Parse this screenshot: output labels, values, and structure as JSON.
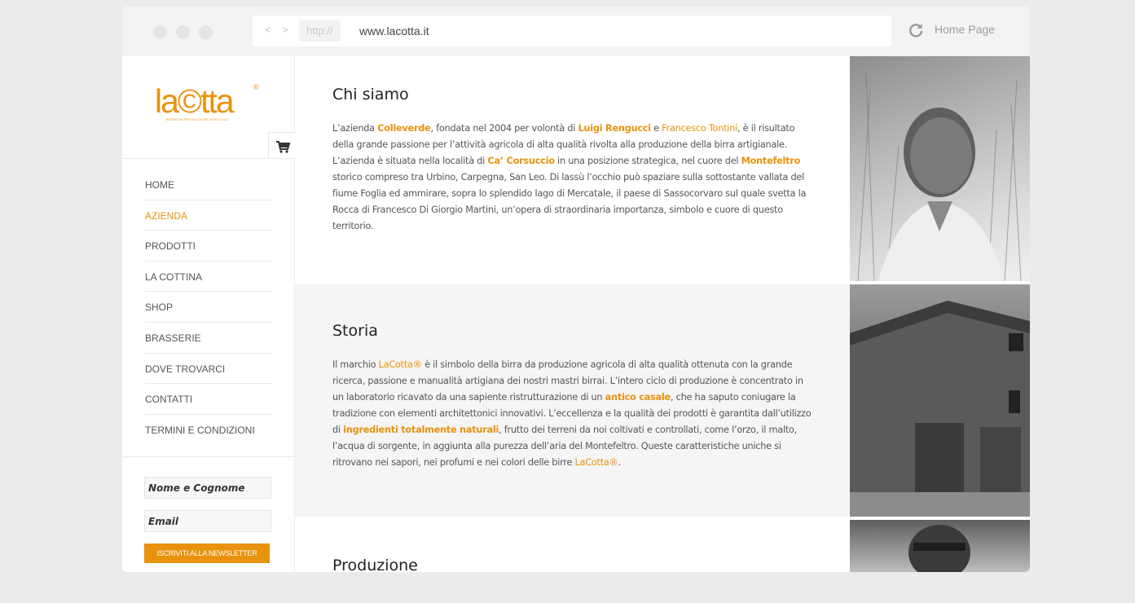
{
  "browser": {
    "nav_arrows": "< >",
    "protocol": "http://",
    "url": "www.lacotta.it",
    "home_link": "Home Page"
  },
  "logo": {
    "text": "la©tta",
    "registered": "®",
    "tagline": "BIRRA DA PRODUZIONE AGRICOLA"
  },
  "menu": {
    "items": [
      "HOME",
      "AZIENDA",
      "PRODOTTI",
      "LA COTTINA",
      "SHOP",
      "BRASSERIE",
      "DOVE TROVARCI",
      "CONTATTI",
      "TERMINI E CONDIZIONI"
    ],
    "active": "AZIENDA"
  },
  "newsletter": {
    "name_placeholder": "Nome e Cognome",
    "email_placeholder": "Email",
    "button": "ISCRIVITI ALLA NEWSLETTER"
  },
  "sections": {
    "chi_siamo": {
      "title": "Chi siamo",
      "t1": "L’azienda ",
      "h1": "Colleverde",
      "t2": ", fondata nel 2004 per volontà di ",
      "h2": "Luigi Rengucci",
      "t3": " e ",
      "h3": "Francesco Tontini",
      "t4": ", è il risultato della grande passione per l’attività agricola di alta qualità rivolta alla produzione della birra artigianale. L’azienda è situata nella località di ",
      "h4": "Ca’ Corsuccio",
      "t5": " in una posizione strategica, nel cuore del ",
      "h5": "Montefeltro",
      "t6": " storico compreso tra Urbino, Carpegna, San Leo. Di lassù l’occhio può spaziare sulla sottostante vallata del fiume Foglia ed ammirare, sopra lo splendido lago di Mercatale, il paese di Sassocorvaro sul quale svetta la Rocca di Francesco Di Giorgio Martini, un’opera di straordinaria importanza, simbolo e cuore di questo territorio."
    },
    "storia": {
      "title": "Storia",
      "t1": "Il marchio ",
      "h1": "LaCotta®",
      "t2": " è il simbolo della birra da produzione agricola di alta qualità ottenuta con la grande ricerca, passione e manualità artigiana dei nostri mastri birrai. L’intero ciclo di produzione è concentrato in un laboratorio ricavato da una sapiente ristrutturazione di un ",
      "h2": "antico casale",
      "t3": ", che ha saputo coniugare la tradizione con elementi architettonici innovativi. L’eccellenza e la qualità dei prodotti è garantita dall’utilizzo di ",
      "h3": "ingredienti totalmente naturali",
      "t4": ", frutto dei terreni da noi coltivati e controllati, come l’orzo, il malto, l’acqua di sorgente, in aggiunta alla purezza dell’aria del Montefeltro. Queste caratteristiche uniche si ritrovano nei sapori, nei profumi e nei colori delle birre ",
      "h4": "LaCotta®",
      "t5": "."
    },
    "produzione": {
      "title": "Produzione"
    }
  },
  "colors": {
    "accent": "#e8920e",
    "background": "#ebebeb"
  }
}
